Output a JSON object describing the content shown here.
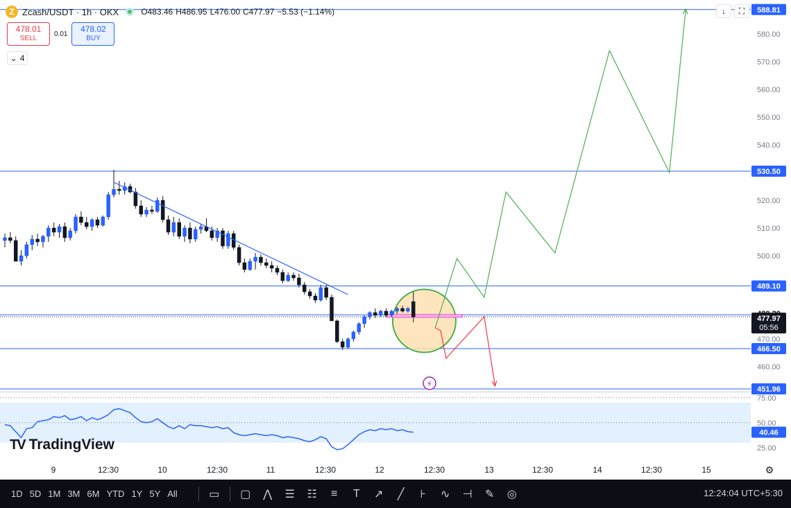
{
  "header": {
    "coin_glyph": "Z",
    "symbol": "Zcash/USDT · 1h · OKX",
    "open_label": "O483.46",
    "high_label": "H486.95",
    "low_label": "L476.00",
    "close_label": "C477.97",
    "change_label": "−5.53 (−1.14%)"
  },
  "trade": {
    "sell_price": "478.01",
    "sell_label": "SELL",
    "spread": "0.01",
    "buy_price": "478.02",
    "buy_label": "BUY"
  },
  "indicators_count": "4",
  "top_icons": [
    "arrow-down-icon",
    "expand-icon"
  ],
  "logo": {
    "mark": "TV",
    "name": "TradingView"
  },
  "bottom": {
    "ranges": [
      "1D",
      "5D",
      "1M",
      "3M",
      "6M",
      "YTD",
      "1Y",
      "5Y",
      "All"
    ],
    "clock": "12:24:04 UTC+5:30"
  },
  "colors": {
    "up": "#131722",
    "down": "#131722",
    "hline": "#2962ff",
    "trend": "#2962ff",
    "bull_path": "#4caf50",
    "bear_path": "#f23645",
    "rsi": "#2962ff",
    "rsi_band": "#e3f0fd",
    "circle_fill": "#ffe0b2",
    "circle_stroke": "#4caf50",
    "last_price_bg": "#131722"
  },
  "chart_data": [
    {
      "type": "candlestick",
      "title": "Zcash/USDT · 1h · OKX",
      "ylim": [
        450,
        590
      ],
      "y_ticks": [
        460,
        470,
        500,
        510,
        520,
        540,
        550,
        560,
        570,
        580
      ],
      "x_ticks": [
        "9",
        "12:30",
        "10",
        "12:30",
        "11",
        "12:30",
        "12",
        "12:30",
        "13",
        "12:30",
        "14",
        "12:30",
        "15"
      ],
      "horizontal_levels": [
        588.81,
        530.5,
        489.1,
        478.7,
        466.5,
        451.96
      ],
      "price_labels": [
        "588.81",
        "530.50",
        "489.10",
        "480.20",
        "478.70",
        "477.97",
        "05:56",
        "466.50",
        "451.96"
      ],
      "last_price": 477.97,
      "countdown": "05:56",
      "candles": [
        {
          "o": 505.5,
          "h": 508.0,
          "l": 503.0,
          "c": 506.5
        },
        {
          "o": 506.5,
          "h": 508.5,
          "l": 504.5,
          "c": 505.5
        },
        {
          "o": 505.5,
          "h": 507.0,
          "l": 499.0,
          "c": 498.0
        },
        {
          "o": 498.0,
          "h": 502.0,
          "l": 496.5,
          "c": 500.0
        },
        {
          "o": 500.0,
          "h": 505.0,
          "l": 499.0,
          "c": 504.0
        },
        {
          "o": 504.0,
          "h": 507.5,
          "l": 502.0,
          "c": 506.0
        },
        {
          "o": 506.0,
          "h": 508.0,
          "l": 503.5,
          "c": 505.0
        },
        {
          "o": 505.0,
          "h": 507.5,
          "l": 503.0,
          "c": 507.0
        },
        {
          "o": 507.0,
          "h": 511.0,
          "l": 505.0,
          "c": 510.0
        },
        {
          "o": 510.0,
          "h": 512.0,
          "l": 507.0,
          "c": 508.5
        },
        {
          "o": 508.5,
          "h": 511.5,
          "l": 506.5,
          "c": 510.5
        },
        {
          "o": 510.5,
          "h": 512.0,
          "l": 505.0,
          "c": 506.5
        },
        {
          "o": 506.5,
          "h": 510.0,
          "l": 505.5,
          "c": 509.0
        },
        {
          "o": 509.0,
          "h": 515.0,
          "l": 508.0,
          "c": 514.0
        },
        {
          "o": 514.0,
          "h": 516.0,
          "l": 511.0,
          "c": 512.0
        },
        {
          "o": 512.0,
          "h": 514.0,
          "l": 509.5,
          "c": 510.5
        },
        {
          "o": 510.5,
          "h": 513.5,
          "l": 509.0,
          "c": 513.0
        },
        {
          "o": 513.0,
          "h": 514.0,
          "l": 510.0,
          "c": 511.0
        },
        {
          "o": 511.0,
          "h": 514.5,
          "l": 510.5,
          "c": 514.0
        },
        {
          "o": 514.0,
          "h": 523.0,
          "l": 513.0,
          "c": 522.0
        },
        {
          "o": 522.0,
          "h": 531.0,
          "l": 521.0,
          "c": 524.0
        },
        {
          "o": 524.0,
          "h": 527.0,
          "l": 522.0,
          "c": 523.5
        },
        {
          "o": 523.5,
          "h": 526.5,
          "l": 522.0,
          "c": 525.0
        },
        {
          "o": 525.0,
          "h": 526.0,
          "l": 522.5,
          "c": 523.0
        },
        {
          "o": 523.0,
          "h": 524.5,
          "l": 517.0,
          "c": 518.0
        },
        {
          "o": 518.0,
          "h": 520.0,
          "l": 514.0,
          "c": 515.0
        },
        {
          "o": 515.0,
          "h": 517.5,
          "l": 514.0,
          "c": 516.5
        },
        {
          "o": 516.5,
          "h": 518.0,
          "l": 515.0,
          "c": 516.0
        },
        {
          "o": 516.0,
          "h": 521.0,
          "l": 515.5,
          "c": 520.0
        },
        {
          "o": 520.0,
          "h": 521.5,
          "l": 512.0,
          "c": 513.0
        },
        {
          "o": 513.0,
          "h": 514.5,
          "l": 507.5,
          "c": 508.5
        },
        {
          "o": 508.5,
          "h": 514.0,
          "l": 507.0,
          "c": 512.0
        },
        {
          "o": 512.0,
          "h": 513.5,
          "l": 506.0,
          "c": 507.0
        },
        {
          "o": 507.0,
          "h": 511.0,
          "l": 505.0,
          "c": 510.0
        },
        {
          "o": 510.0,
          "h": 512.0,
          "l": 504.5,
          "c": 506.0
        },
        {
          "o": 506.0,
          "h": 510.5,
          "l": 505.0,
          "c": 509.5
        },
        {
          "o": 509.5,
          "h": 511.5,
          "l": 508.0,
          "c": 510.5
        },
        {
          "o": 510.5,
          "h": 513.5,
          "l": 508.5,
          "c": 509.0
        },
        {
          "o": 509.0,
          "h": 510.5,
          "l": 505.5,
          "c": 506.5
        },
        {
          "o": 506.5,
          "h": 510.0,
          "l": 505.0,
          "c": 509.0
        },
        {
          "o": 509.0,
          "h": 510.0,
          "l": 502.5,
          "c": 503.5
        },
        {
          "o": 503.5,
          "h": 509.0,
          "l": 502.5,
          "c": 508.0
        },
        {
          "o": 508.0,
          "h": 509.0,
          "l": 502.0,
          "c": 503.0
        },
        {
          "o": 503.0,
          "h": 504.0,
          "l": 496.5,
          "c": 497.5
        },
        {
          "o": 497.5,
          "h": 499.0,
          "l": 494.0,
          "c": 495.0
        },
        {
          "o": 495.0,
          "h": 499.0,
          "l": 494.5,
          "c": 498.0
        },
        {
          "o": 498.0,
          "h": 501.0,
          "l": 495.0,
          "c": 499.5
        },
        {
          "o": 499.5,
          "h": 500.5,
          "l": 496.5,
          "c": 497.5
        },
        {
          "o": 497.5,
          "h": 499.0,
          "l": 495.5,
          "c": 496.5
        },
        {
          "o": 496.5,
          "h": 498.0,
          "l": 494.0,
          "c": 495.5
        },
        {
          "o": 495.5,
          "h": 496.5,
          "l": 493.0,
          "c": 494.0
        },
        {
          "o": 494.0,
          "h": 495.0,
          "l": 490.0,
          "c": 491.0
        },
        {
          "o": 491.0,
          "h": 494.0,
          "l": 490.5,
          "c": 493.0
        },
        {
          "o": 493.0,
          "h": 494.0,
          "l": 491.0,
          "c": 492.0
        },
        {
          "o": 492.0,
          "h": 493.5,
          "l": 488.5,
          "c": 489.5
        },
        {
          "o": 489.5,
          "h": 490.5,
          "l": 486.0,
          "c": 487.0
        },
        {
          "o": 487.0,
          "h": 488.0,
          "l": 484.5,
          "c": 485.5
        },
        {
          "o": 485.5,
          "h": 486.5,
          "l": 483.0,
          "c": 484.0
        },
        {
          "o": 484.0,
          "h": 489.5,
          "l": 483.5,
          "c": 488.5
        },
        {
          "o": 488.5,
          "h": 489.5,
          "l": 484.0,
          "c": 485.0
        },
        {
          "o": 485.0,
          "h": 486.0,
          "l": 477.0,
          "c": 476.5
        },
        {
          "o": 476.5,
          "h": 477.0,
          "l": 468.5,
          "c": 469.0
        },
        {
          "o": 469.0,
          "h": 470.0,
          "l": 466.0,
          "c": 467.0
        },
        {
          "o": 467.0,
          "h": 470.5,
          "l": 466.5,
          "c": 470.0
        },
        {
          "o": 470.0,
          "h": 473.0,
          "l": 469.0,
          "c": 472.5
        },
        {
          "o": 472.5,
          "h": 476.0,
          "l": 471.5,
          "c": 475.5
        },
        {
          "o": 475.5,
          "h": 478.5,
          "l": 474.0,
          "c": 478.0
        },
        {
          "o": 478.0,
          "h": 480.0,
          "l": 477.0,
          "c": 479.5
        },
        {
          "o": 479.5,
          "h": 481.0,
          "l": 477.5,
          "c": 478.5
        },
        {
          "o": 478.5,
          "h": 480.5,
          "l": 478.0,
          "c": 480.0
        },
        {
          "o": 480.0,
          "h": 481.0,
          "l": 478.0,
          "c": 478.5
        },
        {
          "o": 478.5,
          "h": 480.5,
          "l": 478.0,
          "c": 480.0
        },
        {
          "o": 480.0,
          "h": 481.5,
          "l": 479.0,
          "c": 481.0
        },
        {
          "o": 481.0,
          "h": 482.0,
          "l": 479.5,
          "c": 480.0
        },
        {
          "o": 480.0,
          "h": 481.5,
          "l": 479.5,
          "c": 481.0
        },
        {
          "o": 483.46,
          "h": 486.95,
          "l": 476.0,
          "c": 477.97
        }
      ],
      "trendline": [
        [
          20,
          526.5
        ],
        [
          63,
          486.0
        ]
      ],
      "projection_bull": [
        [
          79,
          474
        ],
        [
          83,
          499
        ],
        [
          88,
          485
        ],
        [
          92,
          523
        ],
        [
          101,
          501
        ],
        [
          111,
          574
        ],
        [
          122,
          530
        ],
        [
          125,
          589
        ]
      ],
      "projection_bear": [
        [
          79,
          474
        ],
        [
          80,
          473
        ],
        [
          81,
          463
        ],
        [
          88,
          478
        ],
        [
          90,
          453
        ]
      ],
      "highlight": {
        "center": [
          77,
          476.5
        ],
        "radius_bars": 5.8
      },
      "marker_icon": "lightning-icon"
    },
    {
      "type": "line",
      "title": "",
      "ylim": [
        20,
        80
      ],
      "y_ticks": [
        25.0,
        50.0,
        75.0
      ],
      "y_tick_labels": [
        "25.00",
        "50.00",
        "75.00"
      ],
      "band": [
        30,
        70
      ],
      "last_value_label": "40.46",
      "values": [
        48,
        47,
        41,
        35,
        44,
        45,
        51,
        52,
        53,
        56,
        55,
        57,
        53,
        54,
        56,
        52,
        55,
        53,
        55,
        58,
        63,
        64,
        62,
        60,
        55,
        51,
        50,
        51,
        54,
        50,
        46,
        44,
        47,
        44,
        48,
        47,
        47,
        46,
        45,
        46,
        44,
        45,
        40,
        38,
        37,
        38,
        39,
        38,
        37,
        38,
        37,
        35,
        36,
        35,
        34,
        32,
        31,
        33,
        36,
        34,
        26,
        23,
        24,
        28,
        33,
        38,
        41,
        43,
        42,
        44,
        43,
        44,
        42,
        43,
        41,
        40.46
      ],
      "color": "#2962ff"
    }
  ]
}
